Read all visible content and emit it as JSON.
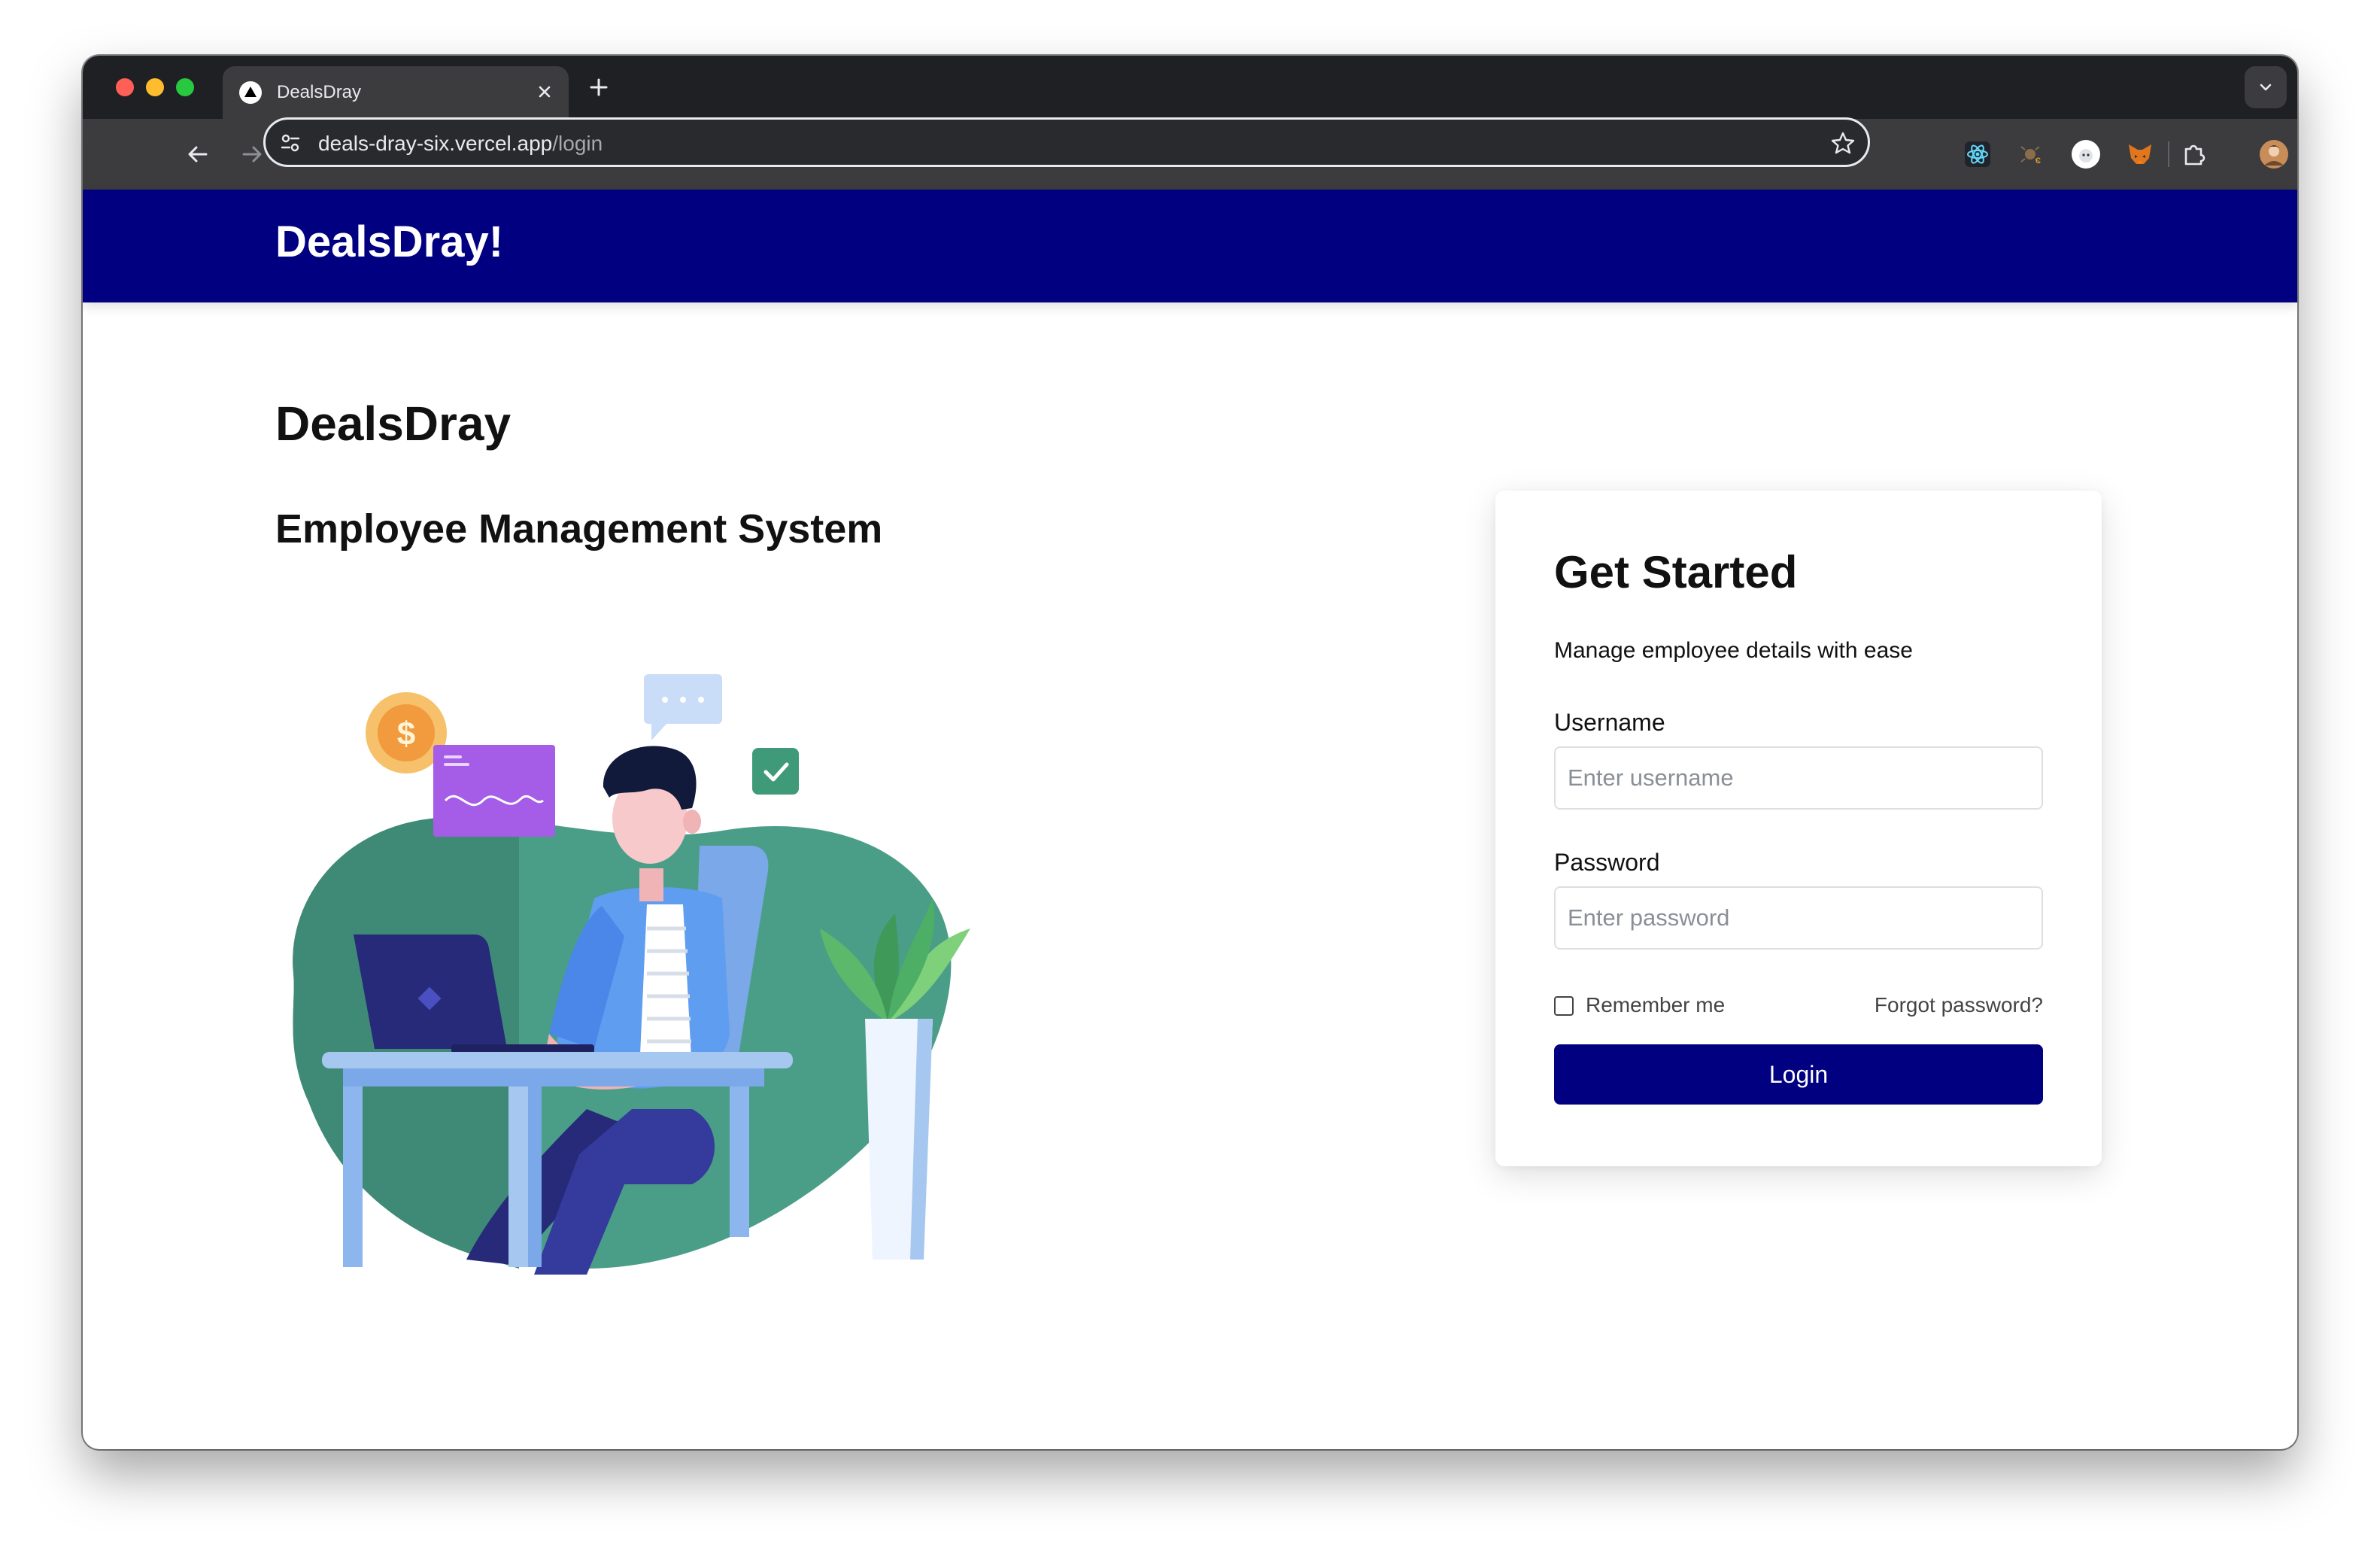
{
  "browser": {
    "tab_title": "DealsDray",
    "url_host": "deals-dray-six.vercel.app",
    "url_path": "/login"
  },
  "site": {
    "brand": "DealsDray!"
  },
  "main": {
    "title": "DealsDray",
    "subtitle": "Employee Management System",
    "illustration_icons": [
      "coin-icon",
      "chart-card-icon",
      "chat-bubble-icon",
      "checkmark-icon",
      "laptop-icon",
      "plant-icon"
    ]
  },
  "login": {
    "heading": "Get Started",
    "description": "Manage employee details with ease",
    "username_label": "Username",
    "username_placeholder": "Enter username",
    "username_value": "",
    "password_label": "Password",
    "password_placeholder": "Enter password",
    "password_value": "",
    "remember_label": "Remember me",
    "remember_checked": false,
    "forgot_label": "Forgot password?",
    "submit_label": "Login"
  },
  "colors": {
    "brand_navy": "#000080",
    "browser_dark": "#1f2023",
    "toolbar": "#3c3c3f",
    "illustration_green": "#4a9e88"
  }
}
